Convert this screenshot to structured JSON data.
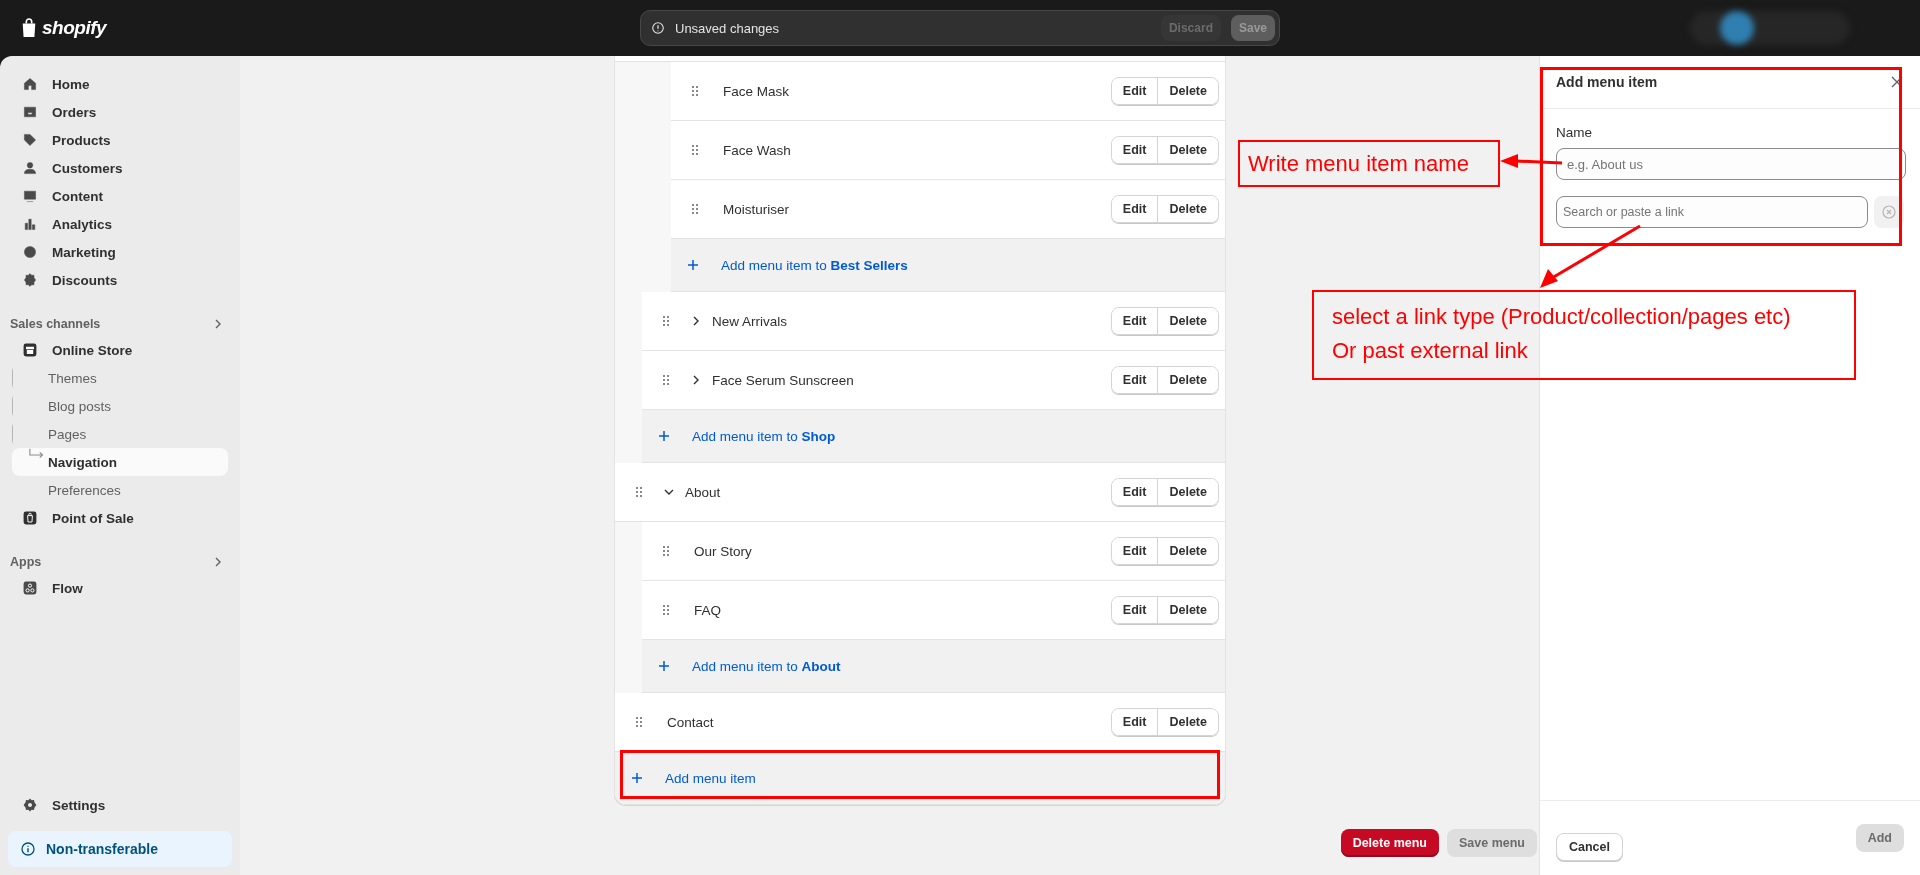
{
  "topbar": {
    "brand": "shopify",
    "notice": "Unsaved changes",
    "buttons": [
      {
        "label": "Discard",
        "disabled": true
      },
      {
        "label": "Save",
        "disabled": true
      }
    ]
  },
  "sidebar": {
    "items": [
      {
        "label": "Home",
        "selected": false
      },
      {
        "label": "Orders",
        "selected": false
      },
      {
        "label": "Products",
        "selected": false
      },
      {
        "label": "Customers",
        "selected": false
      },
      {
        "label": "Content",
        "selected": false
      },
      {
        "label": "Analytics",
        "selected": false
      },
      {
        "label": "Marketing",
        "selected": false
      },
      {
        "label": "Discounts",
        "selected": false
      }
    ],
    "sales_channels": {
      "title": "Sales channels",
      "items": [
        {
          "label": "Online Store",
          "selected": false,
          "children": [
            {
              "label": "Themes",
              "selected": false
            },
            {
              "label": "Blog posts",
              "selected": false
            },
            {
              "label": "Pages",
              "selected": false
            },
            {
              "label": "Navigation",
              "selected": true
            },
            {
              "label": "Preferences",
              "selected": false
            }
          ]
        },
        {
          "label": "Point of Sale",
          "selected": false
        }
      ]
    },
    "apps": {
      "title": "Apps",
      "items": [
        {
          "label": "Flow",
          "selected": false
        }
      ]
    },
    "settings": "Settings",
    "plan_badge": "Non-transferable"
  },
  "menu": {
    "items": [
      {
        "kind": "offscreen",
        "add_label": "Add menu item to **Shop**",
        "children": [
          {
            "kind": "offscreen",
            "add_label": "Add menu item to **Best Sellers**",
            "children": [
              {
                "kind": "item",
                "label": "Face Mask",
                "actions": [
                  "Edit",
                  "Delete"
                ]
              },
              {
                "kind": "item",
                "label": "Face Wash",
                "actions": [
                  "Edit",
                  "Delete"
                ]
              },
              {
                "kind": "item",
                "label": "Moisturiser",
                "actions": [
                  "Edit",
                  "Delete"
                ]
              }
            ]
          },
          {
            "kind": "item",
            "label": "New Arrivals",
            "expanded": false,
            "actions": [
              "Edit",
              "Delete"
            ]
          },
          {
            "kind": "item",
            "label": "Face Serum Sunscreen",
            "expanded": false,
            "actions": [
              "Edit",
              "Delete"
            ]
          }
        ]
      },
      {
        "kind": "item",
        "label": "About",
        "expanded": true,
        "actions": [
          "Edit",
          "Delete"
        ],
        "add_label": "Add menu item to **About**",
        "children": [
          {
            "kind": "item",
            "label": "Our Story",
            "actions": [
              "Edit",
              "Delete"
            ]
          },
          {
            "kind": "item",
            "label": "FAQ",
            "actions": [
              "Edit",
              "Delete"
            ]
          }
        ]
      },
      {
        "kind": "item",
        "label": "Contact",
        "actions": [
          "Edit",
          "Delete"
        ]
      }
    ],
    "add_label": "Add menu item"
  },
  "page_actions": [
    {
      "label": "Delete menu",
      "kind": "danger",
      "disabled": false
    },
    {
      "label": "Save menu",
      "kind": "primary",
      "disabled": true
    }
  ],
  "panel": {
    "title": "Add menu item",
    "name_label": "Name",
    "name_placeholder": "e.g. About us",
    "link_placeholder": "Search or paste a link",
    "buttons": [
      {
        "label": "Cancel",
        "disabled": false
      },
      {
        "label": "Add",
        "disabled": true
      }
    ]
  },
  "annotations": [
    {
      "lines": [
        "Write menu item name"
      ]
    },
    {
      "lines": [
        "select a link type (Product/collection/pages etc)",
        "Or past external link"
      ]
    }
  ]
}
